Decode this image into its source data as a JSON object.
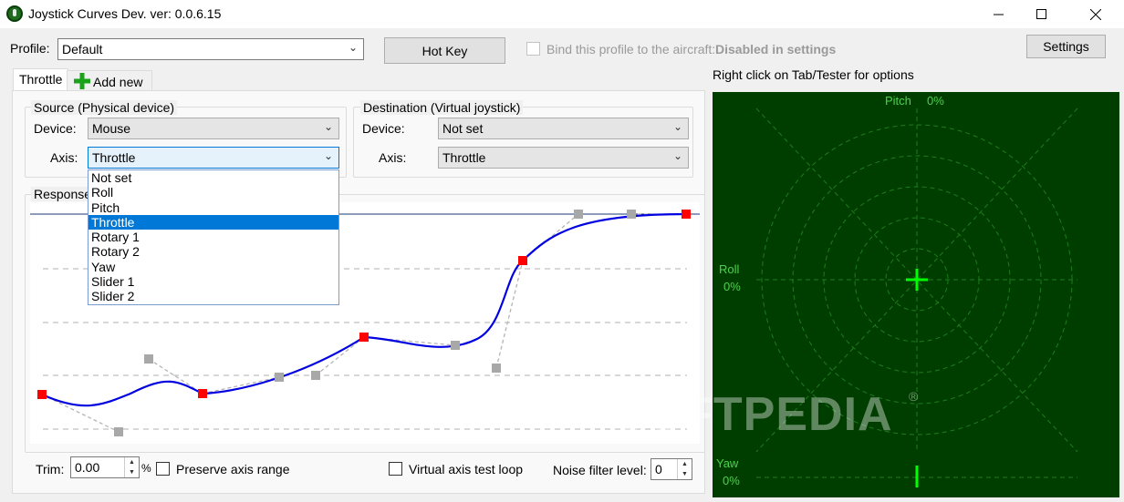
{
  "window": {
    "title": "Joystick Curves Dev. ver: 0.0.6.15",
    "minimize_icon": "minimize-icon",
    "maximize_icon": "maximize-icon",
    "close_icon": "close-icon"
  },
  "toolbar": {
    "profile_label": "Profile:",
    "profile_value": "Default",
    "hotkey_label": "Hot Key",
    "bind_label": "Bind this profile to the aircraft:",
    "bind_status": "Disabled in settings",
    "settings_label": "Settings",
    "hint": "Right click on Tab/Tester for options"
  },
  "tabs": [
    {
      "label": "Throttle",
      "active": true
    },
    {
      "label": "Add new",
      "icon": "plus-icon",
      "icon_color": "#1aa31a"
    }
  ],
  "source": {
    "title": "Source (Physical device)",
    "device_label": "Device:",
    "device_value": "Mouse",
    "axis_label": "Axis:",
    "axis_value": "Throttle",
    "axis_options": [
      "Not set",
      "Roll",
      "Pitch",
      "Throttle",
      "Rotary 1",
      "Rotary 2",
      "Yaw",
      "Slider 1",
      "Slider 2"
    ],
    "selected_index": 3
  },
  "destination": {
    "title": "Destination (Virtual joystick)",
    "device_label": "Device:",
    "device_value": "Not set",
    "axis_label": "Axis:",
    "axis_value": "Throttle"
  },
  "response": {
    "title": "Response",
    "curve_color": "#0000e0",
    "node_color": "#ff0000",
    "handle_color": "#a8a8a8"
  },
  "bottom": {
    "trim_label": "Trim:",
    "trim_value": "0.00",
    "trim_unit": "%",
    "preserve_label": "Preserve axis range",
    "virtual_test_label": "Virtual axis test loop",
    "noise_label": "Noise filter level:",
    "noise_value": "0"
  },
  "tester": {
    "background": "#003e00",
    "accent": "#00ff00",
    "pitch_label": "Pitch",
    "pitch_value": "0%",
    "roll_label": "Roll",
    "roll_value": "0%",
    "yaw_label": "Yaw",
    "yaw_value": "0%",
    "watermark": "SOFTPEDIA",
    "watermark_mark": "®"
  }
}
